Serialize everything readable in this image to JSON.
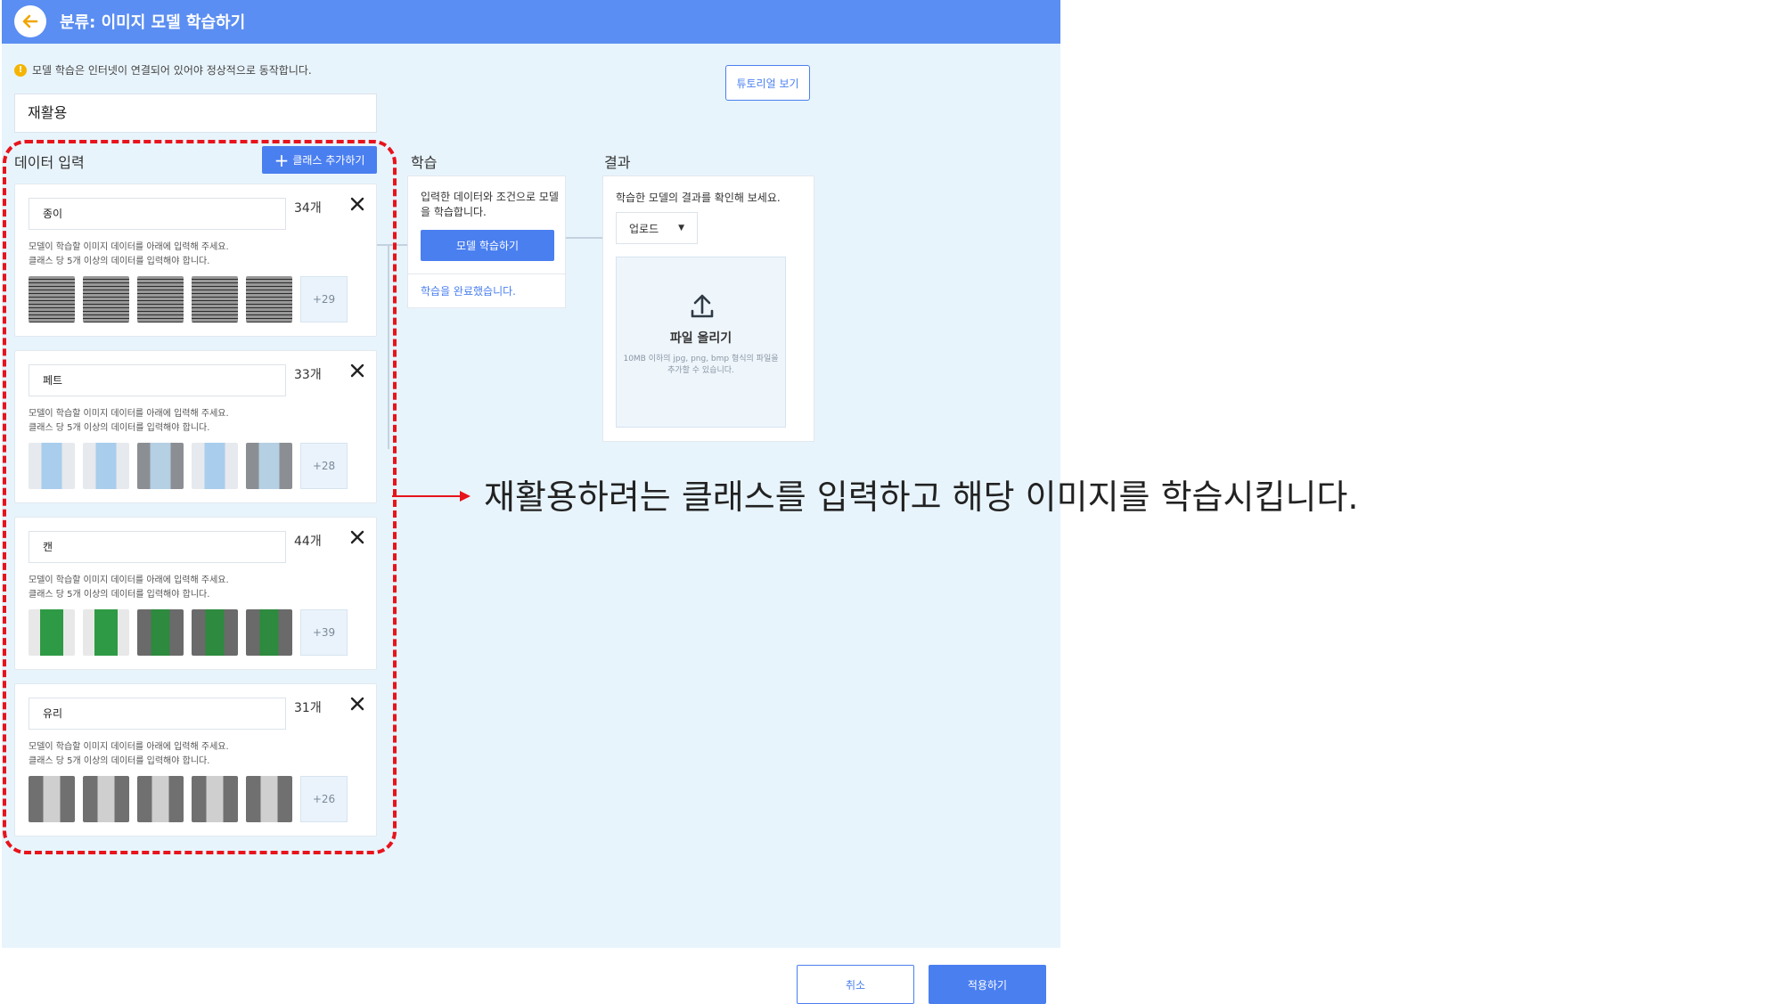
{
  "header": {
    "title": "분류: 이미지 모델 학습하기"
  },
  "notice": {
    "text": "모델 학습은 인터넷이 연결되어 있어야 정상적으로 동작합니다."
  },
  "tutorial_button": "튜토리얼 보기",
  "model_name": "재활용",
  "data_input": {
    "title": "데이터 입력",
    "add_class_label": "클래스 추가하기",
    "description_line1": "모델이 학습할 이미지 데이터를 아래에 입력해 주세요.",
    "description_line2": "클래스 당 5개 이상의 데이터를 입력해야 합니다.",
    "classes": [
      {
        "name": "종이",
        "count": "34개",
        "more": "+29"
      },
      {
        "name": "페트",
        "count": "33개",
        "more": "+28"
      },
      {
        "name": "캔",
        "count": "44개",
        "more": "+39"
      },
      {
        "name": "유리",
        "count": "31개",
        "more": "+26"
      }
    ]
  },
  "training": {
    "title": "학습",
    "description": "입력한 데이터와 조건으로 모델을 학습합니다.",
    "train_button": "모델 학습하기",
    "status": "학습을 완료했습니다."
  },
  "result": {
    "title": "결과",
    "description": "학습한 모델의 결과를 확인해 보세요.",
    "source_select": "업로드",
    "upload_title": "파일 올리기",
    "upload_hint": "10MB 이하의 jpg, png, bmp 형식의 파일을 추가할 수 있습니다."
  },
  "footer": {
    "cancel": "취소",
    "apply": "적용하기"
  },
  "annotation": {
    "text": "재활용하려는 클래스를 입력하고 해당 이미지를 학습시킵니다.",
    "highlight_color": "#e8131b"
  },
  "colors": {
    "accent": "#4a7ff0",
    "header": "#5b8ef2",
    "background": "#e8f4fc"
  }
}
